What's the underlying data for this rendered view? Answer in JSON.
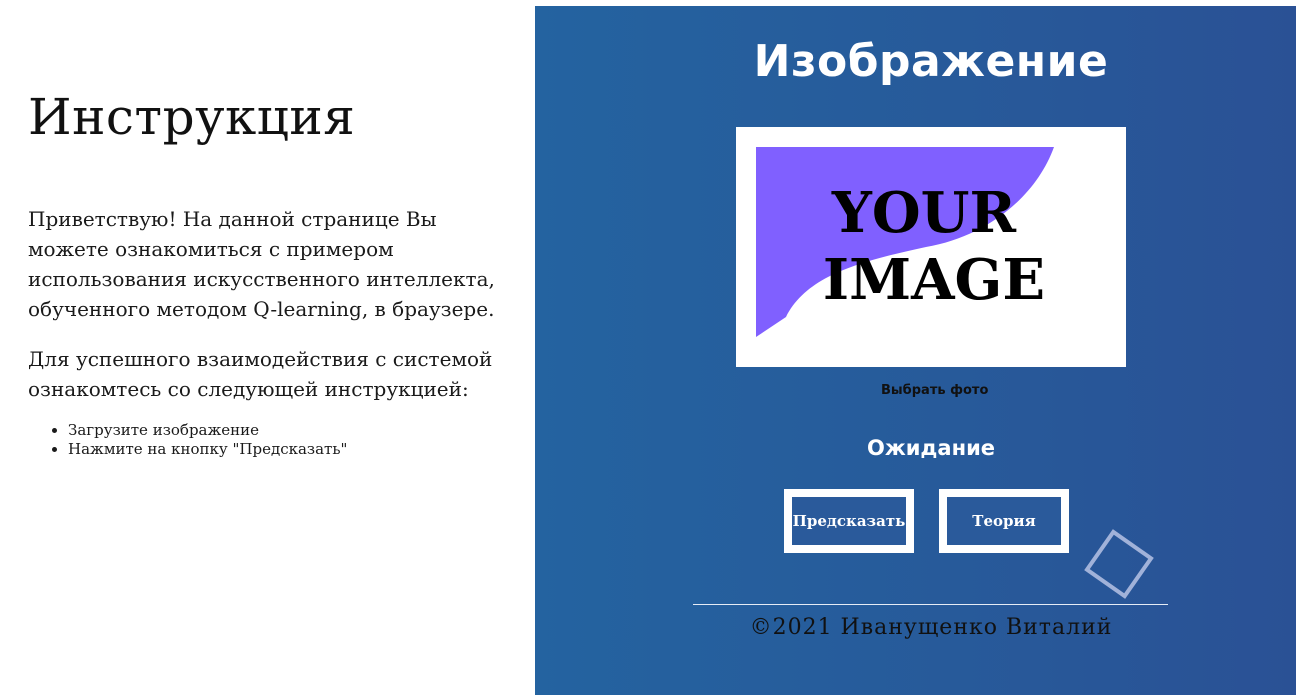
{
  "instructions": {
    "title": "Инструкция",
    "paragraph1": "Приветствую! На данной странице Вы можете ознакомиться с примером использования искусственного интеллекта, обученного методом Q-learning, в браузере.",
    "paragraph2": "Для успешного взаимодействия с системой ознакомтесь со следующей инструкцией:",
    "steps": [
      "Загрузите изображение",
      "Нажмите на кнопку \"Предсказать\""
    ]
  },
  "panel": {
    "title": "Изображение",
    "placeholder_text_line1": "YOUR",
    "placeholder_text_line2": "IMAGE",
    "choose_photo_label": "Выбрать фото",
    "status": "Ожидание",
    "predict_button": "Предсказать",
    "theory_button": "Теория",
    "copyright": "©2021 Иванущенко Виталий"
  },
  "colors": {
    "panel_background": "#275a9a",
    "placeholder_accent": "#8060ff",
    "button_border": "#ffffff"
  }
}
